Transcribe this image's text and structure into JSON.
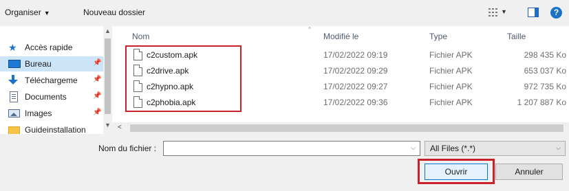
{
  "toolbar": {
    "organize_label": "Organiser",
    "new_folder_label": "Nouveau dossier",
    "help_label": "?"
  },
  "nav": {
    "items": [
      {
        "label": "Accès rapide",
        "icon": "star-icon"
      },
      {
        "label": "Bureau",
        "icon": "desktop-icon",
        "selected": true
      },
      {
        "label": "Téléchargeme",
        "icon": "download-icon"
      },
      {
        "label": "Documents",
        "icon": "documents-icon"
      },
      {
        "label": "Images",
        "icon": "images-icon"
      },
      {
        "label": "Guideinstallation",
        "icon": "folder-icon"
      }
    ]
  },
  "list": {
    "columns": [
      "Nom",
      "Modifié le",
      "Type",
      "Taille"
    ],
    "rows": [
      {
        "name": "c2custom.apk",
        "date": "17/02/2022 09:19",
        "type": "Fichier APK",
        "size": "298 435 Ko"
      },
      {
        "name": "c2drive.apk",
        "date": "17/02/2022 09:29",
        "type": "Fichier APK",
        "size": "653 037 Ko"
      },
      {
        "name": "c2hypno.apk",
        "date": "17/02/2022 09:27",
        "type": "Fichier APK",
        "size": "972 735 Ko"
      },
      {
        "name": "c2phobia.apk",
        "date": "17/02/2022 09:36",
        "type": "Fichier APK",
        "size": "1 207 887 Ko"
      }
    ]
  },
  "bottom": {
    "filename_label": "Nom du fichier :",
    "filename_value": "",
    "filter_value": "All Files (*.*)",
    "open_label": "Ouvrir",
    "cancel_label": "Annuler"
  },
  "colors": {
    "highlight": "#c8212a",
    "selection": "#cce4f7",
    "accent": "#0078d7"
  }
}
